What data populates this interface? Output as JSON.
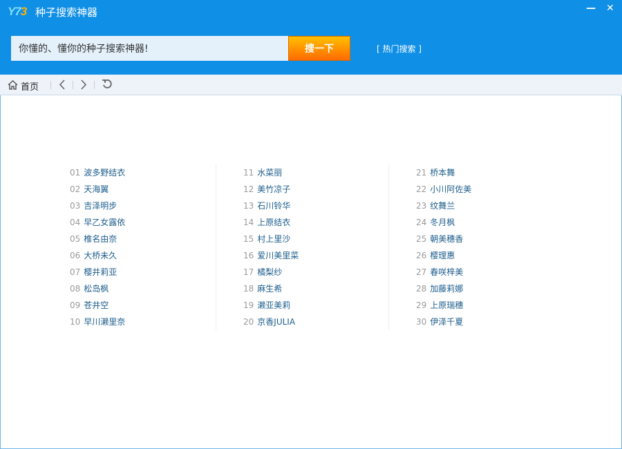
{
  "app": {
    "logo": "Y73",
    "title": "种子搜索神器"
  },
  "window": {
    "minimize": "—",
    "close": "✕"
  },
  "search": {
    "value": "你懂的、懂你的种子搜索神器!",
    "button": "搜一下",
    "hot": "[ 热门搜索 ]"
  },
  "toolbar": {
    "home": "首页"
  },
  "columns": [
    [
      {
        "n": "01",
        "t": "波多野结衣"
      },
      {
        "n": "02",
        "t": "天海翼"
      },
      {
        "n": "03",
        "t": "吉泽明步"
      },
      {
        "n": "04",
        "t": "早乙女露依"
      },
      {
        "n": "05",
        "t": "椎名由奈"
      },
      {
        "n": "06",
        "t": "大桥未久"
      },
      {
        "n": "07",
        "t": "樱井莉亚"
      },
      {
        "n": "08",
        "t": "松岛枫"
      },
      {
        "n": "09",
        "t": "苍井空"
      },
      {
        "n": "10",
        "t": "早川濑里奈"
      }
    ],
    [
      {
        "n": "11",
        "t": "水菜丽"
      },
      {
        "n": "12",
        "t": "美竹凉子"
      },
      {
        "n": "13",
        "t": "石川铃华"
      },
      {
        "n": "14",
        "t": "上原结衣"
      },
      {
        "n": "15",
        "t": "村上里沙"
      },
      {
        "n": "16",
        "t": "爱川美里菜"
      },
      {
        "n": "17",
        "t": "橘梨纱"
      },
      {
        "n": "18",
        "t": "麻生希"
      },
      {
        "n": "19",
        "t": "濑亚美莉"
      },
      {
        "n": "20",
        "t": "京香JULIA"
      }
    ],
    [
      {
        "n": "21",
        "t": "桥本舞"
      },
      {
        "n": "22",
        "t": "小川阿佐美"
      },
      {
        "n": "23",
        "t": "纹舞兰"
      },
      {
        "n": "24",
        "t": "冬月枫"
      },
      {
        "n": "25",
        "t": "朝美穗香"
      },
      {
        "n": "26",
        "t": "樱理惠"
      },
      {
        "n": "27",
        "t": "春咲梓美"
      },
      {
        "n": "28",
        "t": "加藤莉娜"
      },
      {
        "n": "29",
        "t": "上原瑞穗"
      },
      {
        "n": "30",
        "t": "伊泽千夏"
      }
    ]
  ]
}
